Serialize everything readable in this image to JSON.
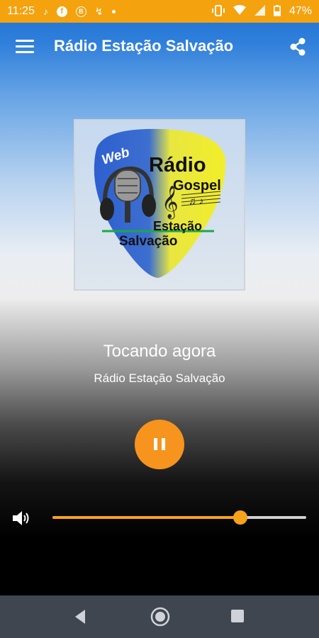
{
  "status_bar": {
    "time": "11:25",
    "battery": "47%",
    "background": "#f5a20f",
    "icons": [
      "music-note-icon",
      "facebook-icon",
      "b-circle-icon",
      "call-forward-icon",
      "dot-icon",
      "vibrate-icon",
      "wifi-icon",
      "signal-icon",
      "battery-icon"
    ],
    "fb_glyph": "f",
    "b_glyph": "B"
  },
  "app_bar": {
    "title": "Rádio Estação Salvação",
    "menu_icon": "hamburger-menu-icon",
    "share_icon": "share-icon"
  },
  "artwork": {
    "logo_text": {
      "web": "Web",
      "radio": "Rádio",
      "gospel": "Gospel",
      "estacao": "Estação",
      "salvacao": "Salvação"
    }
  },
  "player": {
    "now_playing_label": "Tocando agora",
    "station_name": "Rádio Estação Salvação",
    "play_state_icon": "pause-icon",
    "accent_color": "#f7941d",
    "volume": 0.74
  },
  "nav_bar": {
    "icons": [
      "back-icon",
      "home-icon",
      "recents-icon"
    ],
    "background": "#3f4650"
  }
}
